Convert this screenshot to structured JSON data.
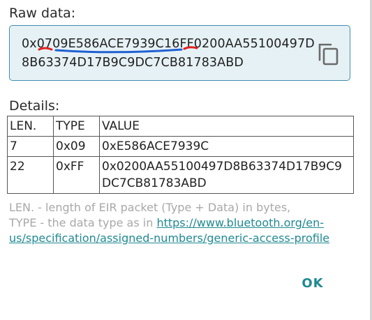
{
  "raw": {
    "label": "Raw data:",
    "value": "0x0709E586ACE7939C16FF0200AA55100497D8B63374D17B9C9DC7CB81783ABD",
    "copy_icon": "copy-icon",
    "box_background": "#e6f1f5",
    "box_border": "#3f8fae"
  },
  "details": {
    "label": "Details:",
    "columns": [
      "LEN.",
      "TYPE",
      "VALUE"
    ],
    "rows": [
      {
        "len": "7",
        "type": "0x09",
        "value": "0xE586ACE7939C"
      },
      {
        "len": "22",
        "type": "0xFF",
        "value": "0x0200AA55100497D8B63374D17B9C9DC7CB81783ABD"
      }
    ]
  },
  "footnote": {
    "line1": "LEN. - length of EIR packet (Type + Data) in bytes,",
    "line2_prefix": "TYPE - the data type as in ",
    "link": "https://www.bluetooth.org/en-us/specification/assigned-numbers/generic-access-profile"
  },
  "actions": {
    "ok_label": "OK"
  },
  "colors": {
    "accent": "#1f8a91",
    "hint_text": "#a8a8a8",
    "annotation_red": "#e02020",
    "annotation_blue": "#2060d0"
  }
}
